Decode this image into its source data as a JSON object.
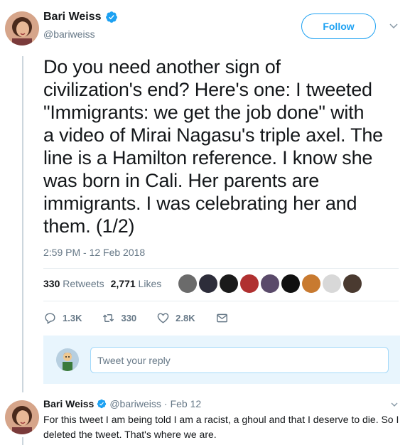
{
  "tweet": {
    "author_name": "Bari Weiss",
    "author_handle": "@bariweiss",
    "follow_label": "Follow",
    "text_lines": [
      "Do you need another sign of",
      "civilization's end? Here's one: I tweeted",
      "\"Immigrants: we get the job done\" with",
      "a video of Mirai Nagasu's triple axel. The",
      "line is a Hamilton reference. I know she",
      "was born in Cali. Her parents are",
      "immigrants. I was celebrating her and",
      "them. (1/2)"
    ],
    "timestamp": "2:59 PM - 12 Feb 2018",
    "retweets_count": "330",
    "retweets_label": "Retweets",
    "likes_count": "2,771",
    "likes_label": "Likes",
    "reply_count": "1.3K",
    "retweet_action_count": "330",
    "like_action_count": "2.8K",
    "reply_placeholder": "Tweet your reply"
  },
  "reply_tweet": {
    "author_name": "Bari Weiss",
    "author_handle": "@bariweiss",
    "separator": "·",
    "date": "Feb 12",
    "text": "For this tweet I am being told I am a racist, a ghoul and that I deserve to die. So I deleted the tweet. That's where we are."
  },
  "likers": [
    "#6b6b6b",
    "#2d2d3a",
    "#1a1a1a",
    "#b03030",
    "#5a4a6a",
    "#101010",
    "#c87a30",
    "#d8d8d8",
    "#4a3a30"
  ],
  "colors": {
    "accent": "#1da1f2",
    "secondary_text": "#657786",
    "primary_text": "#14171a"
  }
}
